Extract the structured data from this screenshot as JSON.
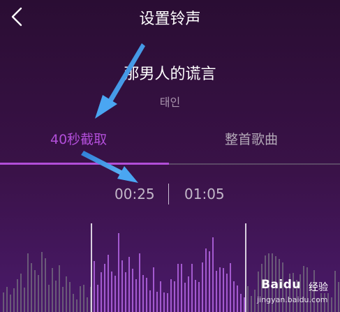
{
  "header": {
    "title": "设置铃声"
  },
  "song": {
    "title": "那男人的谎言",
    "artist": "태인"
  },
  "tabs": [
    {
      "label": "40秒截取",
      "active": true
    },
    {
      "label": "整首歌曲",
      "active": false
    }
  ],
  "selection": {
    "start": "00:25",
    "end": "01:05"
  },
  "watermark": {
    "brand": "Baidu",
    "suffix": "经验",
    "url": "jingyan.baidu.com"
  },
  "colors": {
    "accent": "#b24ed9",
    "annotation_arrow": "#4aa6f2"
  },
  "icons": {
    "back": "chevron-left-icon",
    "annotation": "arrow-icon"
  }
}
